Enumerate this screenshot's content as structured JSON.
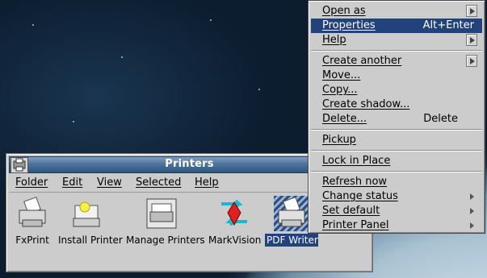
{
  "window": {
    "title": "Printers",
    "menu": [
      "Folder",
      "Edit",
      "View",
      "Selected",
      "Help"
    ],
    "icons": [
      {
        "label": "FxPrint",
        "icon": "printer-icon"
      },
      {
        "label": "Install Printer",
        "icon": "install-printer-icon"
      },
      {
        "label": "Manage Printers",
        "icon": "manage-printers-icon"
      },
      {
        "label": "MarkVision",
        "icon": "markvision-icon"
      },
      {
        "label": "PDF Writer",
        "icon": "pdf-writer-printer-icon",
        "selected": true
      }
    ]
  },
  "context_menu": {
    "items": [
      {
        "label": "Open as",
        "submenu": "button"
      },
      {
        "label": "Properties",
        "accel": "Alt+Enter",
        "highlighted": true
      },
      {
        "label": "Help",
        "submenu": "button"
      },
      {
        "label": "Create another",
        "submenu": "button"
      },
      {
        "label": "Move..."
      },
      {
        "label": "Copy..."
      },
      {
        "label": "Create shadow..."
      },
      {
        "label": "Delete...",
        "accel": "Delete"
      },
      {
        "label": "Pickup"
      },
      {
        "label": "Lock in Place"
      },
      {
        "label": "Refresh now"
      },
      {
        "label": "Change status",
        "submenu": "arrow"
      },
      {
        "label": "Set default",
        "submenu": "arrow"
      },
      {
        "label": "Printer Panel",
        "submenu": "arrow"
      }
    ]
  },
  "colors": {
    "selection": "#21427a",
    "titlebar": "#4f739c",
    "window_bg": "#cccccc"
  }
}
